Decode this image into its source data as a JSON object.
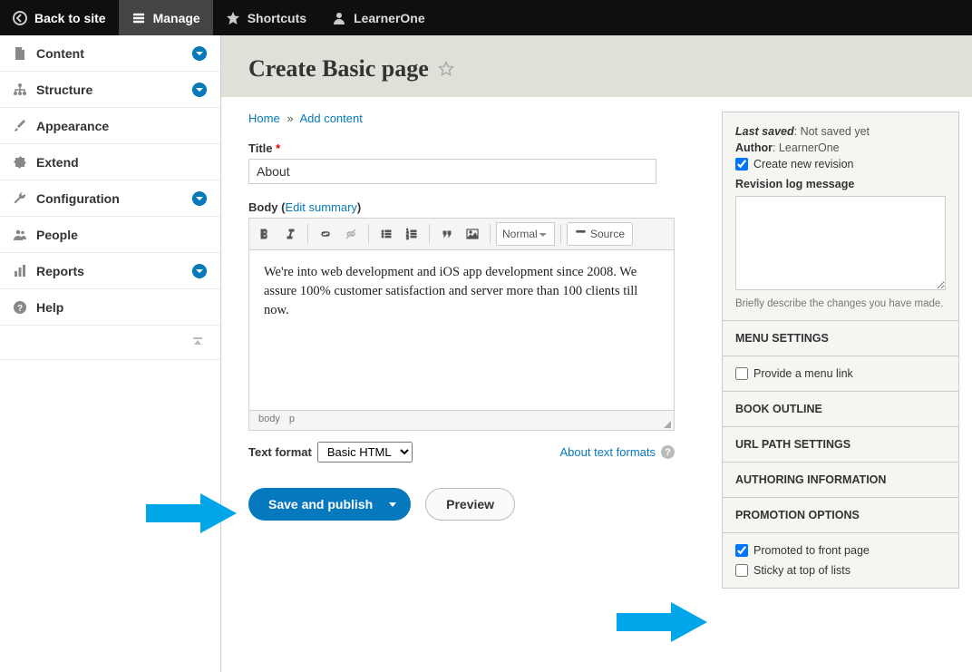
{
  "toolbar": {
    "back": "Back to site",
    "manage": "Manage",
    "shortcuts": "Shortcuts",
    "user": "LearnerOne"
  },
  "sidebar": {
    "items": [
      {
        "label": "Content",
        "expandable": true
      },
      {
        "label": "Structure",
        "expandable": true
      },
      {
        "label": "Appearance",
        "expandable": false
      },
      {
        "label": "Extend",
        "expandable": false
      },
      {
        "label": "Configuration",
        "expandable": true
      },
      {
        "label": "People",
        "expandable": false
      },
      {
        "label": "Reports",
        "expandable": true
      },
      {
        "label": "Help",
        "expandable": false
      }
    ]
  },
  "page": {
    "title": "Create Basic page"
  },
  "breadcrumb": {
    "home": "Home",
    "add": "Add content"
  },
  "form": {
    "title_label": "Title",
    "title_value": "About",
    "body_label": "Body",
    "edit_summary": "Edit summary",
    "body_text": "We're into web development and iOS app development since 2008. We assure 100% customer satisfaction and server more than 100 clients till now.",
    "format_select_label": "Normal",
    "source_btn": "Source",
    "path_body": "body",
    "path_p": "p",
    "text_format_label": "Text format",
    "text_format_value": "Basic HTML",
    "about_formats": "About text formats",
    "save_publish": "Save and publish",
    "preview": "Preview"
  },
  "meta": {
    "last_saved_label": "Last saved",
    "last_saved_value": "Not saved yet",
    "author_label": "Author",
    "author_value": "LearnerOne",
    "new_revision": "Create new revision",
    "revlog_label": "Revision log message",
    "revlog_hint": "Briefly describe the changes you have made."
  },
  "details": {
    "menu_settings": "MENU SETTINGS",
    "provide_menu": "Provide a menu link",
    "book_outline": "BOOK OUTLINE",
    "url_path": "URL PATH SETTINGS",
    "authoring": "AUTHORING INFORMATION",
    "promotion": "PROMOTION OPTIONS",
    "promoted_front": "Promoted to front page",
    "sticky": "Sticky at top of lists"
  }
}
